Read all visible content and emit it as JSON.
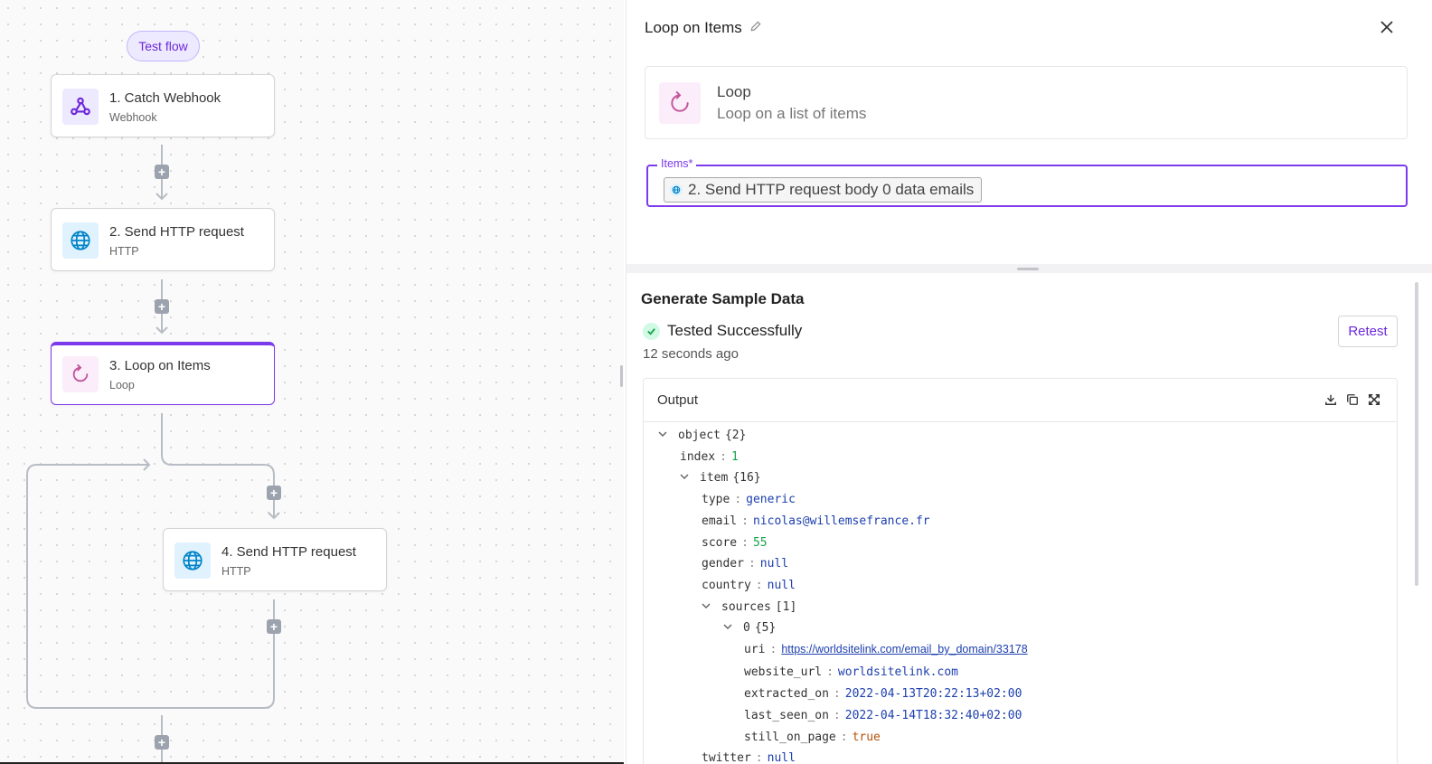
{
  "canvas": {
    "test_flow": "Test flow",
    "steps": [
      {
        "title": "1. Catch Webhook",
        "subtitle": "Webhook",
        "icon": "webhook-icon"
      },
      {
        "title": "2. Send HTTP request",
        "subtitle": "HTTP",
        "icon": "globe-icon"
      },
      {
        "title": "3. Loop on Items",
        "subtitle": "Loop",
        "icon": "loop-icon"
      },
      {
        "title": "4. Send HTTP request",
        "subtitle": "HTTP",
        "icon": "globe-icon"
      }
    ]
  },
  "panel": {
    "title": "Loop on Items",
    "piece": {
      "name": "Loop",
      "description": "Loop on a list of items"
    },
    "items_label": "Items*",
    "items_value": "2. Send HTTP request body 0 data emails",
    "sample": {
      "title": "Generate Sample Data",
      "status": "Tested Successfully",
      "time_ago": "12 seconds ago",
      "retest": "Retest",
      "output_label": "Output"
    },
    "tree": [
      {
        "key": "object",
        "count": "{2}",
        "chev": true
      },
      {
        "key": "index",
        "value": "1",
        "type": "num"
      },
      {
        "key": "item",
        "count": "{16}",
        "chev": true
      },
      {
        "key": "type",
        "value": "generic",
        "type": "str"
      },
      {
        "key": "email",
        "value": "nicolas@willemsefrance.fr",
        "type": "str"
      },
      {
        "key": "score",
        "value": "55",
        "type": "num"
      },
      {
        "key": "gender",
        "value": "null",
        "type": "null"
      },
      {
        "key": "country",
        "value": "null",
        "type": "null"
      },
      {
        "key": "sources",
        "count": "[1]",
        "chev": true
      },
      {
        "key": "0",
        "count": "{5}",
        "chev": true
      },
      {
        "key": "uri",
        "value": "https://worldsitelink.com/email_by_domain/33178",
        "type": "link"
      },
      {
        "key": "website_url",
        "value": "worldsitelink.com",
        "type": "str"
      },
      {
        "key": "extracted_on",
        "value": "2022-04-13T20:22:13+02:00",
        "type": "str"
      },
      {
        "key": "last_seen_on",
        "value": "2022-04-14T18:32:40+02:00",
        "type": "str"
      },
      {
        "key": "still_on_page",
        "value": "true",
        "type": "bool"
      },
      {
        "key": "twitter",
        "value": "null",
        "type": "null"
      }
    ]
  }
}
